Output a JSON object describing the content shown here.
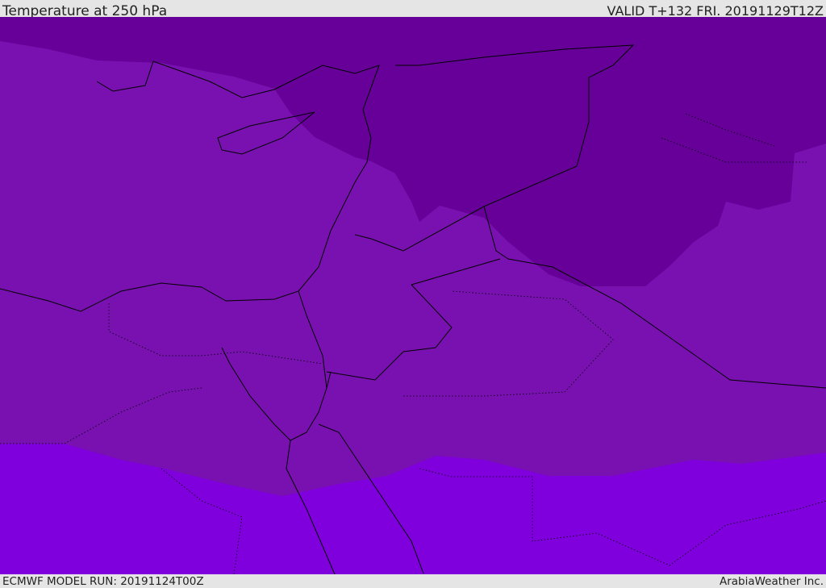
{
  "header": {
    "title": "Temperature at 250 hPa",
    "valid": "VALID T+132 FRI. 20191129T12Z"
  },
  "footer": {
    "model_run": "ECMWF MODEL RUN: 20191124T00Z",
    "credit": "ArabiaWeather Inc."
  },
  "colors": {
    "cold_band": "#660099",
    "mid_band": "#7811b0",
    "warm_band": "#7f00dc",
    "coast": "#000000"
  }
}
